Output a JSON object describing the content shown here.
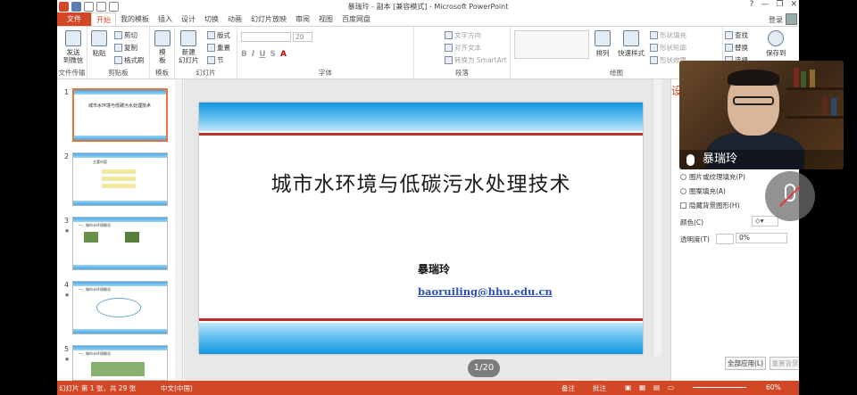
{
  "window": {
    "title": "暴瑞玲 - 副本 [兼容模式] - Microsoft PowerPoint",
    "help": "?",
    "minimize": "—",
    "restore": "❐",
    "close": "✕"
  },
  "tabs": [
    "文件",
    "开始",
    "我的模板",
    "插入",
    "设计",
    "切换",
    "动画",
    "幻灯片放映",
    "审阅",
    "视图",
    "百度网盘"
  ],
  "account": {
    "login_label": "登录"
  },
  "ribbon": {
    "groups": {
      "transfer": "文件传输",
      "clipboard": "剪贴板",
      "template": "模板",
      "slides": "幻灯片",
      "font": "字体",
      "paragraph": "段落",
      "drawing": "绘图"
    },
    "send_label": "发送\n到微信",
    "paste_label": "粘贴",
    "cut_label": "剪切",
    "copy_label": "复制",
    "format_painter_label": "格式刷",
    "template_label": "模\n板",
    "new_slide_label": "新建\n幻灯片",
    "layout_label": "版式",
    "reset_label": "重置",
    "section_label": "节",
    "font_size": "20",
    "text_direction_label": "文字方向",
    "align_text_label": "对齐文本",
    "convert_smartart_label": "转换为 SmartArt",
    "arrange_label": "排列",
    "quick_styles_label": "快速样式",
    "shape_fill_label": "形状填充",
    "shape_outline_label": "形状轮廓",
    "shape_effect_label": "形状效果",
    "find_label": "查找",
    "replace_label": "替换",
    "select_label": "选择",
    "save_to_label": "保存到"
  },
  "thumbnails": [
    {
      "num": "1",
      "title": "城市水环境与低碳污水处理技术",
      "selected": true
    },
    {
      "num": "2",
      "title": "主要内容"
    },
    {
      "num": "3",
      "title": "一、城市水环境概况"
    },
    {
      "num": "4",
      "title": "一、城市水环境概况"
    },
    {
      "num": "5",
      "title": "一、城市水环境概况"
    }
  ],
  "slide": {
    "title": "城市水环境与低碳污水处理技术",
    "author": "暴瑞玲",
    "email": "baoruiling@hhu.edu.cn"
  },
  "page_indicator": "1/20",
  "format_pane": {
    "title": "设",
    "options": {
      "picture_texture_fill": "图片或纹理填充(P)",
      "pattern_fill": "图案填充(A)",
      "hide_background": "隐藏背景图形(H)"
    },
    "color_label": "颜色(C)",
    "transparency_label": "透明度(T)",
    "transparency_value": "0%",
    "apply_all_label": "全部应用(L)",
    "reset_bg_label": "重置背景(B)"
  },
  "status_bar": {
    "slide_info": "幻灯片 第 1 张，共 29 张",
    "language": "中文(中国)",
    "notes_label": "备注",
    "comments_label": "批注",
    "zoom": "60%"
  },
  "video": {
    "participant_name": "暴瑞玲"
  },
  "colors": {
    "accent": "#d24726",
    "slide_band": "#1296df",
    "slide_line": "#c0302b",
    "email": "#2a4fb8"
  }
}
